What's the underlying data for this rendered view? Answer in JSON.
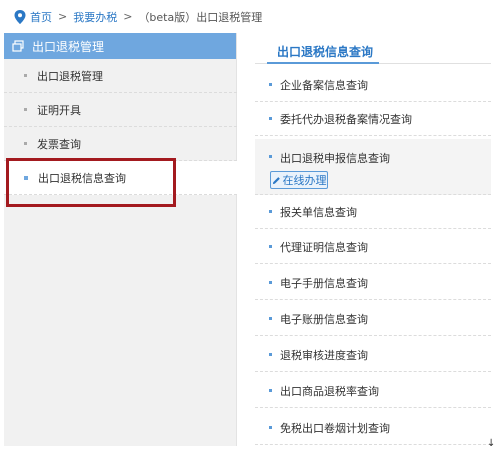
{
  "breadcrumb": {
    "home": "首页",
    "sep": ">",
    "level1": "我要办税",
    "current": "（beta版）出口退税管理"
  },
  "sidebar": {
    "title": "出口退税管理",
    "items": [
      {
        "label": "出口退税管理"
      },
      {
        "label": "证明开具"
      },
      {
        "label": "发票查询"
      },
      {
        "label": "出口退税信息查询"
      }
    ]
  },
  "main": {
    "title": "出口退税信息查询",
    "items": [
      {
        "label": "企业备案信息查询"
      },
      {
        "label": "委托代办退税备案情况查询"
      },
      {
        "label": "出口退税申报信息查询"
      },
      {
        "label": "报关单信息查询"
      },
      {
        "label": "代理证明信息查询"
      },
      {
        "label": "电子手册信息查询"
      },
      {
        "label": "电子账册信息查询"
      },
      {
        "label": "退税审核进度查询"
      },
      {
        "label": "出口商品退税率查询"
      },
      {
        "label": "免税出口卷烟计划查询"
      }
    ],
    "online_label": "在线办理"
  },
  "footer_mark": "↓",
  "colors": {
    "accent": "#2b78c5",
    "sidebar_header": "#6fa7df",
    "highlight": "#a31a1f"
  },
  "icons": {
    "home": "location-pin-icon",
    "sidebar_header": "window-icon",
    "online": "pencil-icon"
  }
}
